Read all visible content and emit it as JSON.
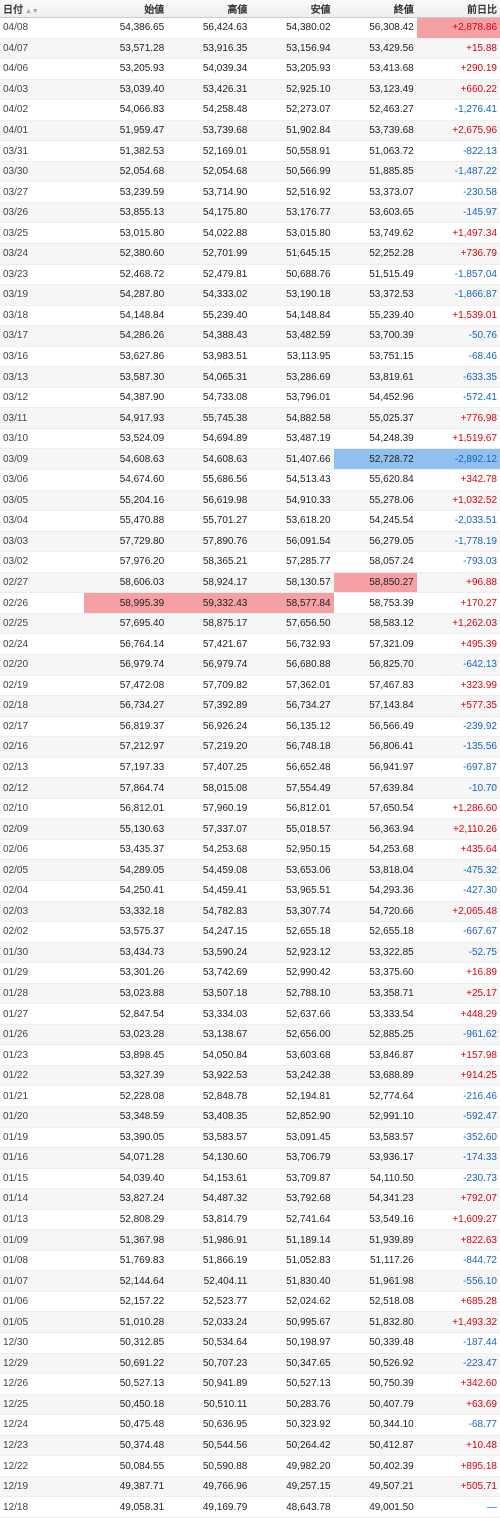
{
  "header": {
    "date": "日付",
    "open": "始値",
    "high": "高値",
    "low": "安値",
    "close": "終値",
    "change": "前日比"
  },
  "sort_icon": "sort-arrows-icon",
  "highlight_colors": {
    "high": "#f4a0a5",
    "low": "#8fc0ef"
  },
  "change_colors": {
    "up": "#e0000f",
    "down": "#1565c0"
  },
  "rows": [
    [
      "04/08",
      "54,386.65",
      "56,424.63",
      "54,380.02",
      "56,308.42",
      "+2,878.86"
    ],
    [
      "04/07",
      "53,571.28",
      "53,916.35",
      "53,156.94",
      "53,429.56",
      "+15.88"
    ],
    [
      "04/06",
      "53,205.93",
      "54,039.34",
      "53,205.93",
      "53,413.68",
      "+290.19"
    ],
    [
      "04/03",
      "53,039.40",
      "53,426.31",
      "52,925.10",
      "53,123.49",
      "+660.22"
    ],
    [
      "04/02",
      "54,066.83",
      "54,258.48",
      "52,273.07",
      "52,463.27",
      "-1,276.41"
    ],
    [
      "04/01",
      "51,959.47",
      "53,739.68",
      "51,902.84",
      "53,739.68",
      "+2,675.96"
    ],
    [
      "03/31",
      "51,382.53",
      "52,169.01",
      "50,558.91",
      "51,063.72",
      "-822.13"
    ],
    [
      "03/30",
      "52,054.68",
      "52,054.68",
      "50,566.99",
      "51,885.85",
      "-1,487.22"
    ],
    [
      "03/27",
      "53,239.59",
      "53,714.90",
      "52,516.92",
      "53,373.07",
      "-230.58"
    ],
    [
      "03/26",
      "53,855.13",
      "54,175.80",
      "53,176.77",
      "53,603.65",
      "-145.97"
    ],
    [
      "03/25",
      "53,015.80",
      "54,022.88",
      "53,015.80",
      "53,749.62",
      "+1,497.34"
    ],
    [
      "03/24",
      "52,380.60",
      "52,701.99",
      "51,645.15",
      "52,252.28",
      "+736.79"
    ],
    [
      "03/23",
      "52,468.72",
      "52,479.81",
      "50,688.76",
      "51,515.49",
      "-1,857.04"
    ],
    [
      "03/19",
      "54,287.80",
      "54,333.02",
      "53,190.18",
      "53,372.53",
      "-1,866.87"
    ],
    [
      "03/18",
      "54,148.84",
      "55,239.40",
      "54,148.84",
      "55,239.40",
      "+1,539.01"
    ],
    [
      "03/17",
      "54,286.26",
      "54,388.43",
      "53,482.59",
      "53,700.39",
      "-50.76"
    ],
    [
      "03/16",
      "53,627.86",
      "53,983.51",
      "53,113.95",
      "53,751.15",
      "-68.46"
    ],
    [
      "03/13",
      "53,587.30",
      "54,065.31",
      "53,286.69",
      "53,819.61",
      "-633.35"
    ],
    [
      "03/12",
      "54,387.90",
      "54,733.08",
      "53,796.01",
      "54,452.96",
      "-572.41"
    ],
    [
      "03/11",
      "54,917.93",
      "55,745.38",
      "54,882.58",
      "55,025.37",
      "+776.98"
    ],
    [
      "03/10",
      "53,524.09",
      "54,694.89",
      "53,487.19",
      "54,248.39",
      "+1,519.67"
    ],
    [
      "03/09",
      "54,608.63",
      "54,608.63",
      "51,407.66",
      "52,728.72",
      "-2,892.12"
    ],
    [
      "03/06",
      "54,674.60",
      "55,686.56",
      "54,513.43",
      "55,620.84",
      "+342.78"
    ],
    [
      "03/05",
      "55,204.16",
      "56,619.98",
      "54,910.33",
      "55,278.06",
      "+1,032.52"
    ],
    [
      "03/04",
      "55,470.88",
      "55,701.27",
      "53,618.20",
      "54,245.54",
      "-2,033.51"
    ],
    [
      "03/03",
      "57,729.80",
      "57,890.76",
      "56,091.54",
      "56,279.05",
      "-1,778.19"
    ],
    [
      "03/02",
      "57,976.20",
      "58,365.21",
      "57,285.77",
      "58,057.24",
      "-793.03"
    ],
    [
      "02/27",
      "58,606.03",
      "58,924.17",
      "58,130.57",
      "58,850.27",
      "+96.88"
    ],
    [
      "02/26",
      "58,995.39",
      "59,332.43",
      "58,577.84",
      "58,753.39",
      "+170.27"
    ],
    [
      "02/25",
      "57,695.40",
      "58,875.17",
      "57,656.50",
      "58,583.12",
      "+1,262.03"
    ],
    [
      "02/24",
      "56,764.14",
      "57,421.67",
      "56,732.93",
      "57,321.09",
      "+495.39"
    ],
    [
      "02/20",
      "56,979.74",
      "56,979.74",
      "56,680.88",
      "56,825.70",
      "-642.13"
    ],
    [
      "02/19",
      "57,472.08",
      "57,709.82",
      "57,362.01",
      "57,467.83",
      "+323.99"
    ],
    [
      "02/18",
      "56,734.27",
      "57,392.89",
      "56,734.27",
      "57,143.84",
      "+577.35"
    ],
    [
      "02/17",
      "56,819.37",
      "56,926.24",
      "56,135.12",
      "56,566.49",
      "-239.92"
    ],
    [
      "02/16",
      "57,212.97",
      "57,219.20",
      "56,748.18",
      "56,806.41",
      "-135.56"
    ],
    [
      "02/13",
      "57,197.33",
      "57,407.25",
      "56,652.48",
      "56,941.97",
      "-697.87"
    ],
    [
      "02/12",
      "57,864.74",
      "58,015.08",
      "57,554.49",
      "57,639.84",
      "-10.70"
    ],
    [
      "02/10",
      "56,812.01",
      "57,960.19",
      "56,812.01",
      "57,650.54",
      "+1,286.60"
    ],
    [
      "02/09",
      "55,130.63",
      "57,337.07",
      "55,018.57",
      "56,363.94",
      "+2,110.26"
    ],
    [
      "02/06",
      "53,435.37",
      "54,253.68",
      "52,950.15",
      "54,253.68",
      "+435.64"
    ],
    [
      "02/05",
      "54,289.05",
      "54,459.08",
      "53,653.06",
      "53,818.04",
      "-475.32"
    ],
    [
      "02/04",
      "54,250.41",
      "54,459.41",
      "53,965.51",
      "54,293.36",
      "-427.30"
    ],
    [
      "02/03",
      "53,332.18",
      "54,782.83",
      "53,307.74",
      "54,720.66",
      "+2,065.48"
    ],
    [
      "02/02",
      "53,575.37",
      "54,247.15",
      "52,655.18",
      "52,655.18",
      "-667.67"
    ],
    [
      "01/30",
      "53,434.73",
      "53,590.24",
      "52,923.12",
      "53,322.85",
      "-52.75"
    ],
    [
      "01/29",
      "53,301.26",
      "53,742.69",
      "52,990.42",
      "53,375.60",
      "+16.89"
    ],
    [
      "01/28",
      "53,023.88",
      "53,507.18",
      "52,788.10",
      "53,358.71",
      "+25.17"
    ],
    [
      "01/27",
      "52,847.54",
      "53,334.03",
      "52,637.66",
      "53,333.54",
      "+448.29"
    ],
    [
      "01/26",
      "53,023.28",
      "53,138.67",
      "52,656.00",
      "52,885.25",
      "-961.62"
    ],
    [
      "01/23",
      "53,898.45",
      "54,050.84",
      "53,603.68",
      "53,846.87",
      "+157.98"
    ],
    [
      "01/22",
      "53,327.39",
      "53,922.53",
      "53,242.38",
      "53,688.89",
      "+914.25"
    ],
    [
      "01/21",
      "52,228.08",
      "52,848.78",
      "52,194.81",
      "52,774.64",
      "-216.46"
    ],
    [
      "01/20",
      "53,348.59",
      "53,408.35",
      "52,852.90",
      "52,991.10",
      "-592.47"
    ],
    [
      "01/19",
      "53,390.05",
      "53,583.57",
      "53,091.45",
      "53,583.57",
      "-352.60"
    ],
    [
      "01/16",
      "54,071.28",
      "54,130.60",
      "53,706.79",
      "53,936.17",
      "-174.33"
    ],
    [
      "01/15",
      "54,039.40",
      "54,153.61",
      "53,709.87",
      "54,110.50",
      "-230.73"
    ],
    [
      "01/14",
      "53,827.24",
      "54,487.32",
      "53,792.68",
      "54,341.23",
      "+792.07"
    ],
    [
      "01/13",
      "52,808.29",
      "53,814.79",
      "52,741.64",
      "53,549.16",
      "+1,609.27"
    ],
    [
      "01/09",
      "51,367.98",
      "51,986.91",
      "51,189.14",
      "51,939.89",
      "+822.63"
    ],
    [
      "01/08",
      "51,769.83",
      "51,866.19",
      "51,052.83",
      "51,117.26",
      "-844.72"
    ],
    [
      "01/07",
      "52,144.64",
      "52,404.11",
      "51,830.40",
      "51,961.98",
      "-556.10"
    ],
    [
      "01/06",
      "52,157.22",
      "52,523.77",
      "52,024.62",
      "52,518.08",
      "+685.28"
    ],
    [
      "01/05",
      "51,010.28",
      "52,033.24",
      "50,995.67",
      "51,832.80",
      "+1,493.32"
    ],
    [
      "12/30",
      "50,312.85",
      "50,534.64",
      "50,198.97",
      "50,339.48",
      "-187.44"
    ],
    [
      "12/29",
      "50,691.22",
      "50,707.23",
      "50,347.65",
      "50,526.92",
      "-223.47"
    ],
    [
      "12/26",
      "50,527.13",
      "50,941.89",
      "50,527.13",
      "50,750.39",
      "+342.60"
    ],
    [
      "12/25",
      "50,450.18",
      "50,510.11",
      "50,283.76",
      "50,407.79",
      "+63.69"
    ],
    [
      "12/24",
      "50,475.48",
      "50,636.95",
      "50,323.92",
      "50,344.10",
      "-68.77"
    ],
    [
      "12/23",
      "50,374.48",
      "50,544.56",
      "50,264.42",
      "50,412.87",
      "+10.48"
    ],
    [
      "12/22",
      "50,084.55",
      "50,590.88",
      "49,982.20",
      "50,402.39",
      "+895.18"
    ],
    [
      "12/19",
      "49,387.71",
      "49,766.96",
      "49,257.15",
      "49,507.21",
      "+505.71"
    ],
    [
      "12/18",
      "49,058.31",
      "49,169.79",
      "48,643.78",
      "49,001.50",
      "—"
    ]
  ],
  "highlights": {
    "0": {
      "5": "high"
    },
    "21": {
      "4": "low",
      "5": "low"
    },
    "27": {
      "4": "high"
    },
    "28": {
      "1": "high",
      "2": "high",
      "3": "high"
    },
    "73": {
      "1": "low",
      "2": "low",
      "3": "low",
      "4": "low"
    }
  }
}
